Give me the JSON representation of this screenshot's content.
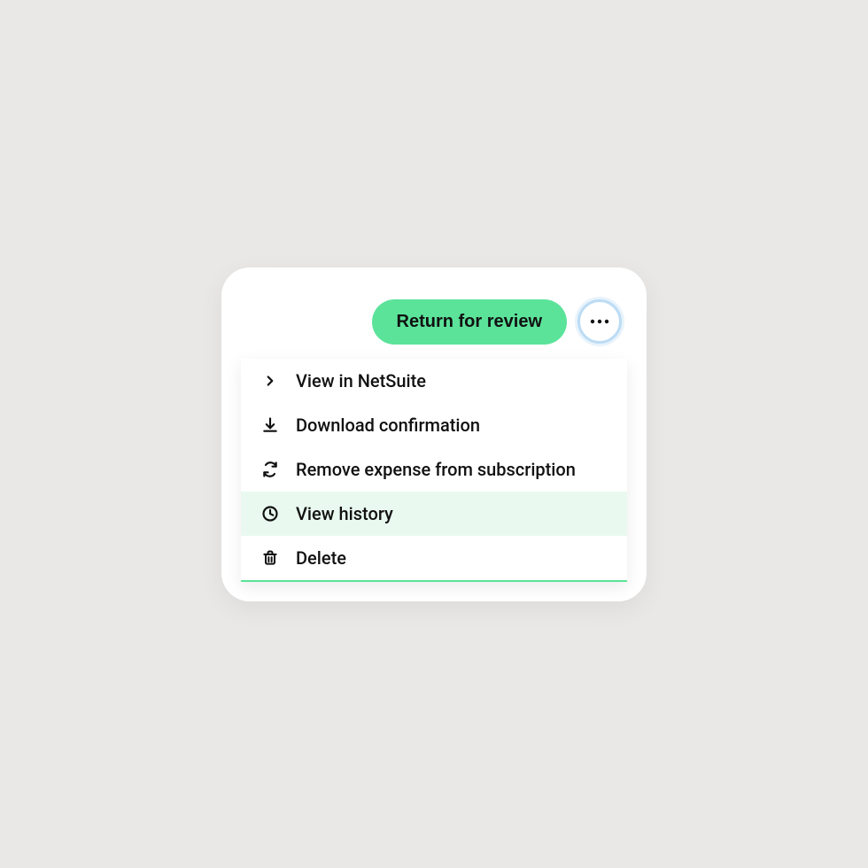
{
  "toolbar": {
    "primary_label": "Return for review"
  },
  "menu": {
    "items": [
      {
        "label": "View in NetSuite",
        "icon": "chevron-right-icon",
        "highlight": false
      },
      {
        "label": "Download confirmation",
        "icon": "download-icon",
        "highlight": false
      },
      {
        "label": "Remove expense from subscription",
        "icon": "refresh-icon",
        "highlight": false
      },
      {
        "label": "View history",
        "icon": "clock-icon",
        "highlight": true
      },
      {
        "label": "Delete",
        "icon": "trash-icon",
        "highlight": false
      }
    ]
  },
  "colors": {
    "accent": "#5be39a",
    "more_button_ring": "#bcdcf4",
    "highlight_bg": "#e9f9ef"
  }
}
